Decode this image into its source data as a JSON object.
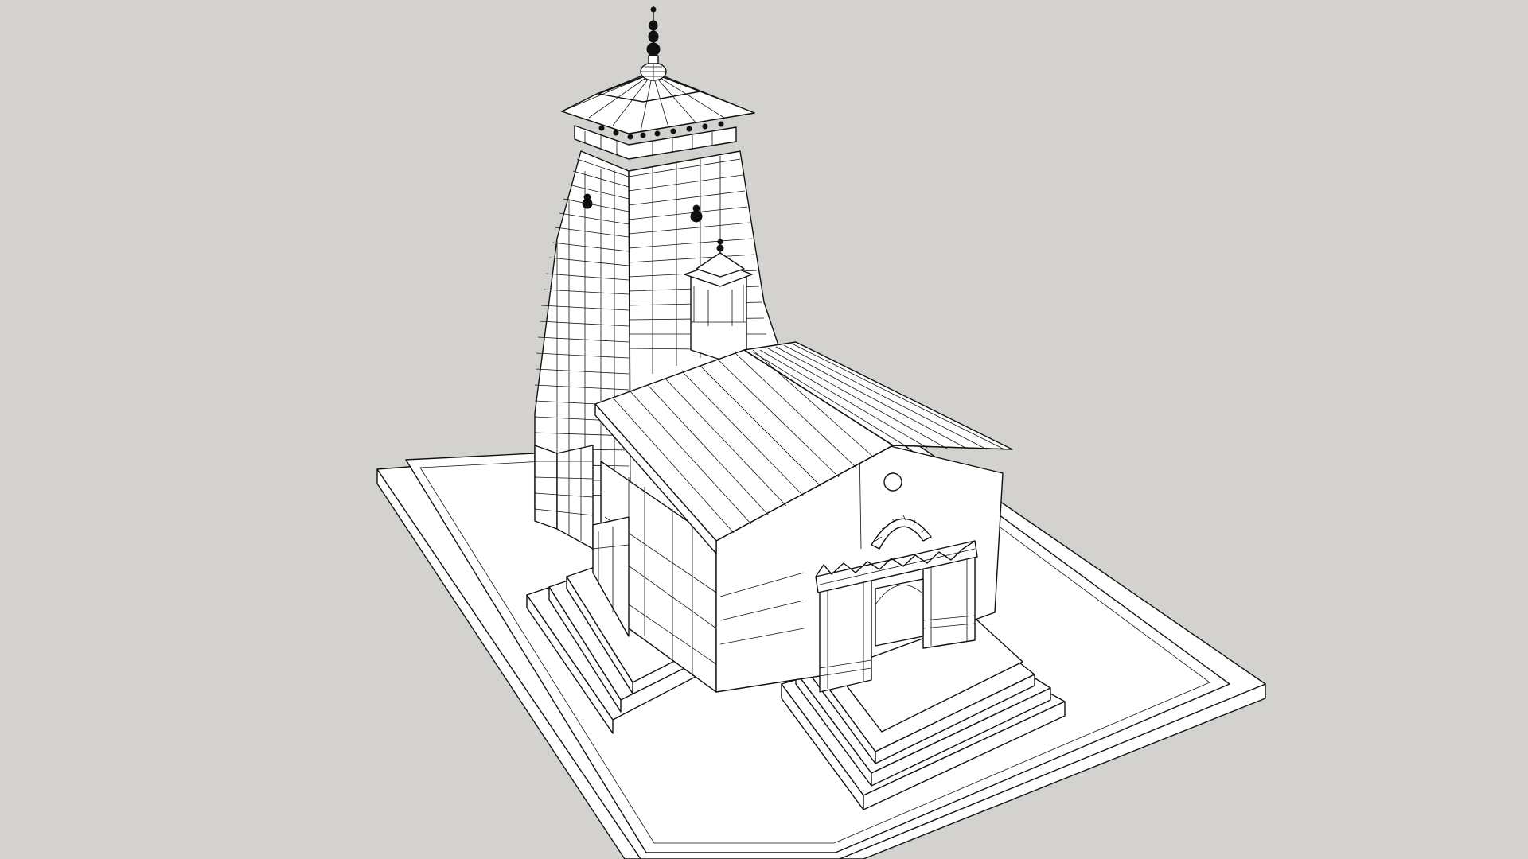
{
  "scene": {
    "background_color": "#d3d2ce",
    "line_color": "#111111",
    "face_color": "#ffffff",
    "subject": "temple-model-line-render"
  }
}
